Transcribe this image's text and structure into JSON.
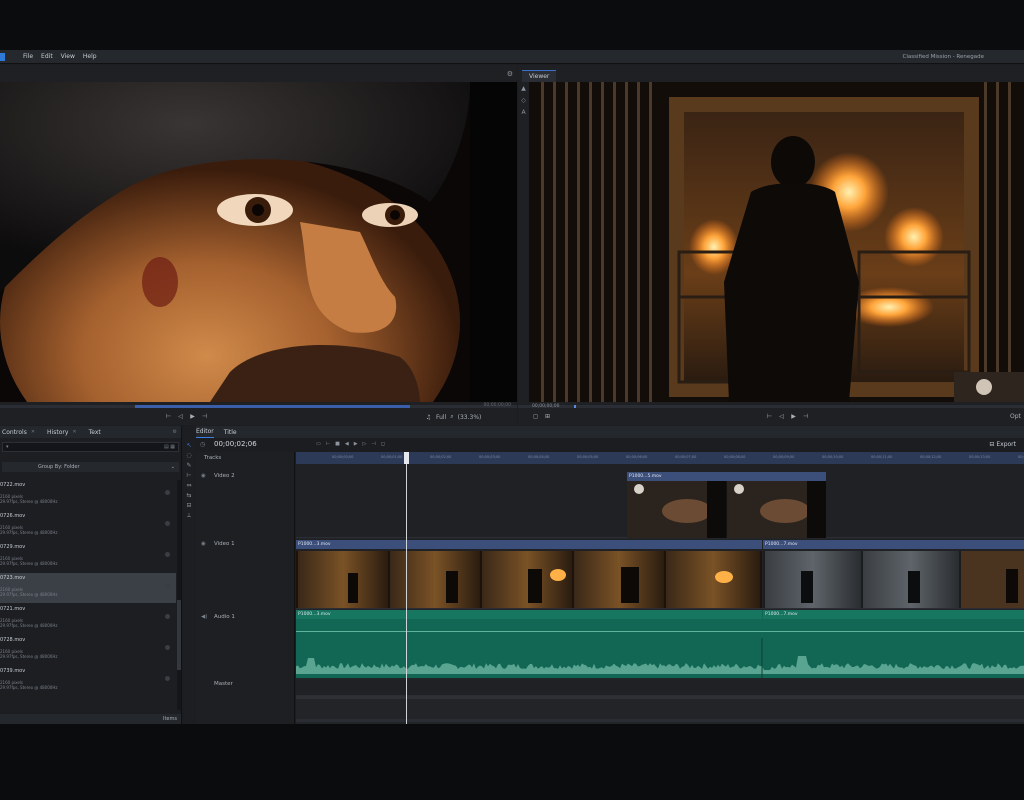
{
  "menubar": {
    "items": [
      "File",
      "Edit",
      "View",
      "Help"
    ],
    "window_title": "Classified Mission - Renegade"
  },
  "left_viewer": {
    "timecode_small": "00;00;00;00",
    "zoom_label": "Full",
    "zoom_percent": "(33.3%)",
    "playhead_fraction": 0.47
  },
  "right_viewer": {
    "tab_label": "Viewer",
    "timecode_small": "00;00;00;00",
    "options_label": "Opt",
    "playhead_fraction": 0.06
  },
  "media_panel": {
    "tabs": [
      "Controls",
      "History",
      "Text"
    ],
    "group_by": "Group By: Folder",
    "items": [
      {
        "name": "0722.mov",
        "meta1": "2160 pixels",
        "meta2": "29.97fps, Stereo @ 48000Hz"
      },
      {
        "name": "0726.mov",
        "meta1": "2160 pixels",
        "meta2": "29.97fps, Stereo @ 48000Hz"
      },
      {
        "name": "0729.mov",
        "meta1": "2160 pixels",
        "meta2": "29.97fps, Stereo @ 48000Hz"
      },
      {
        "name": "0723.mov",
        "meta1": "2160 pixels",
        "meta2": "29.97fps, Stereo @ 48000Hz",
        "selected": true
      },
      {
        "name": "0721.mov",
        "meta1": "2160 pixels",
        "meta2": "29.97fps, Stereo @ 48000Hz"
      },
      {
        "name": "0728.mov",
        "meta1": "2160 pixels",
        "meta2": "29.97fps, Stereo @ 48000Hz"
      },
      {
        "name": "0739.mov",
        "meta1": "2160 pixels",
        "meta2": "29.97fps, Stereo @ 48000Hz"
      }
    ],
    "footer_label": "Items"
  },
  "editor": {
    "tabs": [
      "Editor",
      "Title"
    ],
    "timecode": "00;00;02;06",
    "export_label": "Export",
    "tracks_label": "Tracks",
    "tracks": [
      {
        "name": "Video 2",
        "icon": "eye-icon"
      },
      {
        "name": "Video 1",
        "icon": "eye-icon"
      },
      {
        "name": "Audio 1",
        "icon": "speaker-icon"
      },
      {
        "name": "Master",
        "icon": ""
      }
    ],
    "clips": {
      "video2": "P1000...5.mov",
      "video1_a": "P1000...3.mov",
      "video1_b": "P1000...7.mov",
      "audio1_a": "P1000...3.mov",
      "audio1_b": "P1000...7.mov"
    },
    "ruler_ticks": [
      "00;00;00;00",
      "00;00;01;00",
      "00;00;02;00",
      "00;00;03;00",
      "00;00;04;00",
      "00;00;05;00",
      "00;00;06;00",
      "00;00;07;00",
      "00;00;08;00",
      "00;00;09;00",
      "00;00;10;00",
      "00;00;11;00",
      "00;00;12;00",
      "00;00;13;00",
      "00;00;14;00"
    ]
  },
  "colors": {
    "accent": "#3a7ee0",
    "video_clip_header": "#3c4f7a",
    "audio_clip": "#126654",
    "background": "#1b1d21"
  }
}
